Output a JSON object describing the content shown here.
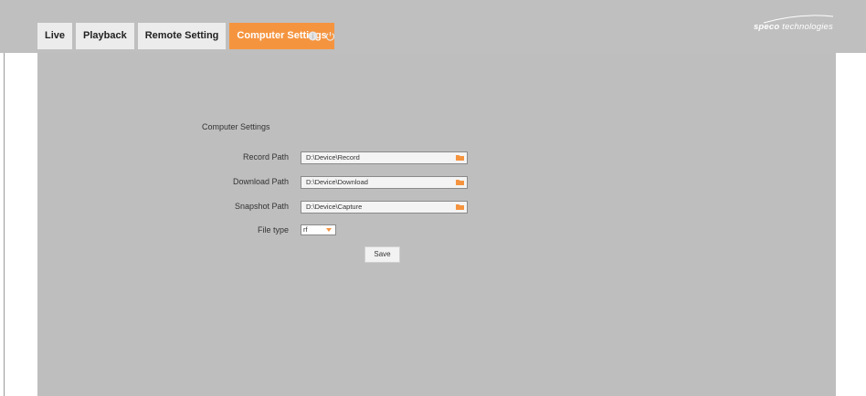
{
  "tabs": [
    {
      "label": "Live",
      "active": false
    },
    {
      "label": "Playback",
      "active": false
    },
    {
      "label": "Remote Setting",
      "active": false
    },
    {
      "label": "Computer Settings",
      "active": true
    }
  ],
  "header_icons": [
    "info-icon",
    "power-icon"
  ],
  "brand": {
    "logo_bold": "speco",
    "logo_rest": " technologies"
  },
  "colors": {
    "accent": "#f5943f",
    "topbar": "#bfbfbf",
    "panel": "#bebebe"
  },
  "form": {
    "title": "Computer Settings",
    "record_path": {
      "label": "Record Path",
      "value": "D:\\Device\\Record"
    },
    "download_path": {
      "label": "Download Path",
      "value": "D:\\Device\\Download"
    },
    "snapshot_path": {
      "label": "Snapshot Path",
      "value": "D:\\Device\\Capture"
    },
    "file_type": {
      "label": "File type",
      "value": "rf"
    },
    "save_label": "Save"
  }
}
